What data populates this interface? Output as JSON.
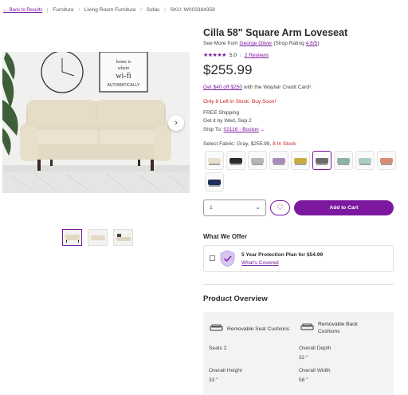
{
  "breadcrumb": {
    "back": "← Back to Results",
    "items": [
      "Furniture",
      "Living Room Furniture",
      "Sofas"
    ],
    "sku": "SKU: W003384358"
  },
  "product": {
    "title": "Cilla 58\" Square Arm Loveseat",
    "see_more_prefix": "See More from ",
    "brand": "George Oliver",
    "shop_rating_prefix": " (Shop Rating ",
    "shop_rating": "4.6/5",
    "shop_rating_suffix": ")",
    "stars": "★★★★★",
    "rating": "5.0",
    "reviews": "2 Reviews",
    "price": "$255.99",
    "credit_link": "Get $40 off $250",
    "credit_text": " with the Wayfair Credit Card¹.",
    "stock": "Only 8 Left in Stock. Buy Soon!",
    "shipping": "FREE Shipping",
    "delivery": "Get it by Wed, Sep 2",
    "ship_to_label": "Ship To: ",
    "ship_to": "02116 - Boston",
    "fabric_label": "Select Fabric: Gray, $255.99, ",
    "fabric_stock": "8 In Stock"
  },
  "swatches": [
    {
      "name": "beige",
      "color": "#e8e0cf"
    },
    {
      "name": "black",
      "color": "#2a2a2a"
    },
    {
      "name": "light-gray",
      "color": "#b9b5bd"
    },
    {
      "name": "lavender",
      "color": "#a98ab8"
    },
    {
      "name": "mustard",
      "color": "#c9ae3d"
    },
    {
      "name": "gray",
      "color": "#6b6b6b"
    },
    {
      "name": "sage",
      "color": "#8fb2a6"
    },
    {
      "name": "aqua",
      "color": "#a9cdc7"
    },
    {
      "name": "coral",
      "color": "#d98c73"
    },
    {
      "name": "navy",
      "color": "#1e2f5c"
    }
  ],
  "purchase": {
    "qty": "1",
    "add_to_cart": "Add to Cart"
  },
  "offer": {
    "heading": "What We Offer",
    "plan": "5 Year Protection Plan for $54.99",
    "covered": "What's Covered"
  },
  "overview": {
    "heading": "Product Overview",
    "feature1": "Removable Seat Cushions",
    "feature2": "Removable Back Cushions",
    "specs": [
      {
        "label": "Seats",
        "value": "2"
      },
      {
        "label": "Overall Depth",
        "value": "32 ''"
      },
      {
        "label": "Overall Height",
        "value": "33 ''"
      },
      {
        "label": "Overall Width",
        "value": "58 ''"
      }
    ]
  },
  "colors": {
    "accent": "#7b189f",
    "alert": "#c81b1b",
    "sofa": "#e6dcc8"
  }
}
